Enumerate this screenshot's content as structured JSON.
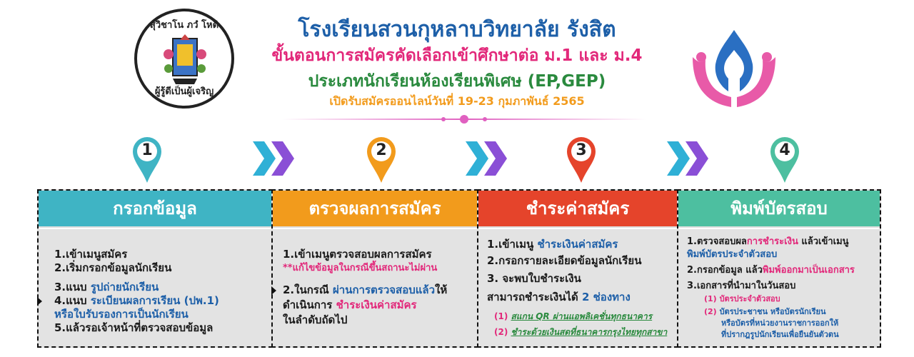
{
  "header": {
    "school_name": "โรงเรียนสวนกุหลาบวิทยาลัย รังสิต",
    "subtitle": "ขั้นตอนการสมัครคัดเลือกเข้าศึกษาต่อ ม.1 และ ม.4",
    "program": "ประเภทนักเรียนห้องเรียนพิเศษ (EP,GEP)",
    "dates": "เปิดรับสมัครออนไลน์วันที่ 19-23 กุมภาพันธ์ 2565",
    "seal_motto_top": "สุวิชาโน ภวํ โหติ",
    "seal_motto_bottom": "ผู้รู้ดีเป็นผู้เจริญ"
  },
  "colors": {
    "step1": "#3fb4c4",
    "step2": "#f29b1c",
    "step3": "#e5442b",
    "step4": "#4dbfa0",
    "chevron_a": "#2fb0d6",
    "chevron_b": "#8a4fd6"
  },
  "steps": [
    {
      "number": "1",
      "title": "กรอกข้อมูล",
      "lines": [
        {
          "text": "1.เข้าเมนูสมัคร"
        },
        {
          "text": "2.เริ่มกรอกข้อมูลนักเรียน"
        },
        {
          "prefix": "3.แนบ ",
          "highlight": "รูปถ่ายนักเรียน"
        },
        {
          "prefix": "4.แนบ ",
          "highlight": "ระเบียนผลการเรียน (ปพ.1)"
        },
        {
          "highlight": "หรือใบรับรองการเป็นนักเรียน"
        },
        {
          "text": "5.แล้วรอเจ้าหน้าที่ตรวจสอบข้อมูล"
        }
      ]
    },
    {
      "number": "2",
      "title": "ตรวจผลการสมัคร",
      "lines": [
        {
          "text": "1.เข้าเมนูตรวจสอบผลการสมัคร"
        },
        {
          "note": "**แก้ไขข้อมูลในกรณีขึ้นสถานะไม่ผ่าน"
        },
        {
          "prefix": "2.ในกรณี ",
          "highlight": "ผ่านการตรวจสอบแล้ว",
          "suffix": "ให้"
        },
        {
          "prefix": "ดำเนินการ ",
          "highlight": "ชำระเงินค่าสมัคร"
        },
        {
          "text": "ในลำดับถัดไป"
        }
      ]
    },
    {
      "number": "3",
      "title": "ชำระค่าสมัคร",
      "lines": [
        {
          "prefix": "1.เข้าเมนู ",
          "highlight": "ชำระเงินค่าสมัคร"
        },
        {
          "text": "2.กรอกรายละเอียดข้อมูลนักเรียน"
        },
        {
          "text": "3. จะพบใบชำระเงิน"
        },
        {
          "prefix": "สามารถชำระเงินได้ ",
          "highlight": "2 ช่องทาง"
        }
      ],
      "options": [
        {
          "num": "(1)",
          "text": "สแกน QR ผ่านแอพลิเคชั่นทุกธนาคาร"
        },
        {
          "num": "(2)",
          "text": "ชำระด้วยเงินสดที่ธนาคารกรุงไทยทุกสาขา"
        }
      ]
    },
    {
      "number": "4",
      "title": "พิมพ์บัตรสอบ",
      "lines": [
        {
          "prefix": "1.ตรวจสอบผล",
          "highlight": "การชำระเงิน",
          "suffix": " แล้วเข้าเมนู"
        },
        {
          "highlight": "พิมพ์บัตรประจำตัวสอบ"
        },
        {
          "prefix": "2.กรอกข้อมูล แล้ว",
          "highlight": "พิมพ์ออกมาเป็นเอกสาร"
        },
        {
          "text": "3.เอกสารที่นำมาในวันสอบ"
        }
      ],
      "documents": [
        {
          "num": "(1)",
          "text": "บัตรประจำตัวสอบ"
        },
        {
          "num": "(2)",
          "text": "บัตรประชาชน หรือบัตรนักเรียน"
        },
        {
          "num": "",
          "text": "หรือบัตรที่หน่วยงานราชการออกให้"
        },
        {
          "num": "",
          "text": "ที่ปรากฎรูปนักเรียนเพื่อยืนยันตัวตน"
        }
      ]
    }
  ]
}
